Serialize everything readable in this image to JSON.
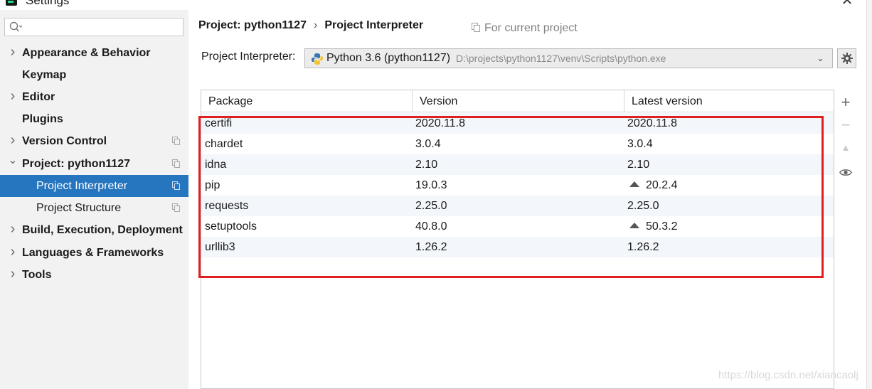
{
  "window": {
    "title": "Settings",
    "close_glyph": "✕"
  },
  "search": {
    "placeholder": "",
    "icon": "search-icon"
  },
  "sidebar": {
    "items": [
      {
        "label": "Appearance & Behavior",
        "chevron": "›",
        "bold": true
      },
      {
        "label": "Keymap",
        "chevron": "",
        "bold": true
      },
      {
        "label": "Editor",
        "chevron": "›",
        "bold": true
      },
      {
        "label": "Plugins",
        "chevron": "",
        "bold": true
      },
      {
        "label": "Version Control",
        "chevron": "›",
        "bold": true
      },
      {
        "label": "Project: python1127",
        "chevron": "⌄",
        "bold": true
      },
      {
        "label": "Project Interpreter",
        "chevron": "",
        "bold": false,
        "selected": true
      },
      {
        "label": "Project Structure",
        "chevron": "",
        "bold": false
      },
      {
        "label": "Build, Execution, Deployment",
        "chevron": "›",
        "bold": true
      },
      {
        "label": "Languages & Frameworks",
        "chevron": "›",
        "bold": true
      },
      {
        "label": "Tools",
        "chevron": "›",
        "bold": true
      }
    ]
  },
  "breadcrumb": {
    "project": "Project: python1127",
    "separator": "›",
    "page": "Project Interpreter"
  },
  "scope_note": "For current project",
  "interpreter": {
    "label": "Project Interpreter:",
    "name": "Python 3.6 (python1127)",
    "path": "D:\\projects\\python1127\\venv\\Scripts\\python.exe",
    "dropdown_glyph": "⌄"
  },
  "packages": {
    "columns": [
      "Package",
      "Version",
      "Latest version"
    ],
    "rows": [
      {
        "package": "certifi",
        "version": "2020.11.8",
        "latest": "2020.11.8",
        "upgrade": false
      },
      {
        "package": "chardet",
        "version": "3.0.4",
        "latest": "3.0.4",
        "upgrade": false
      },
      {
        "package": "idna",
        "version": "2.10",
        "latest": "2.10",
        "upgrade": false
      },
      {
        "package": "pip",
        "version": "19.0.3",
        "latest": "20.2.4",
        "upgrade": true
      },
      {
        "package": "requests",
        "version": "2.25.0",
        "latest": "2.25.0",
        "upgrade": false
      },
      {
        "package": "setuptools",
        "version": "40.8.0",
        "latest": "50.3.2",
        "upgrade": true
      },
      {
        "package": "urllib3",
        "version": "1.26.2",
        "latest": "1.26.2",
        "upgrade": false
      }
    ]
  },
  "toolbar": {
    "add": "+",
    "remove": "−",
    "upgrade": "▲",
    "show_early": "👁"
  },
  "colors": {
    "selection": "#2675bf",
    "highlight": "#e02020",
    "sidebar_bg": "#f2f2f2"
  },
  "watermark": "https://blog.csdn.net/xiancaolj"
}
